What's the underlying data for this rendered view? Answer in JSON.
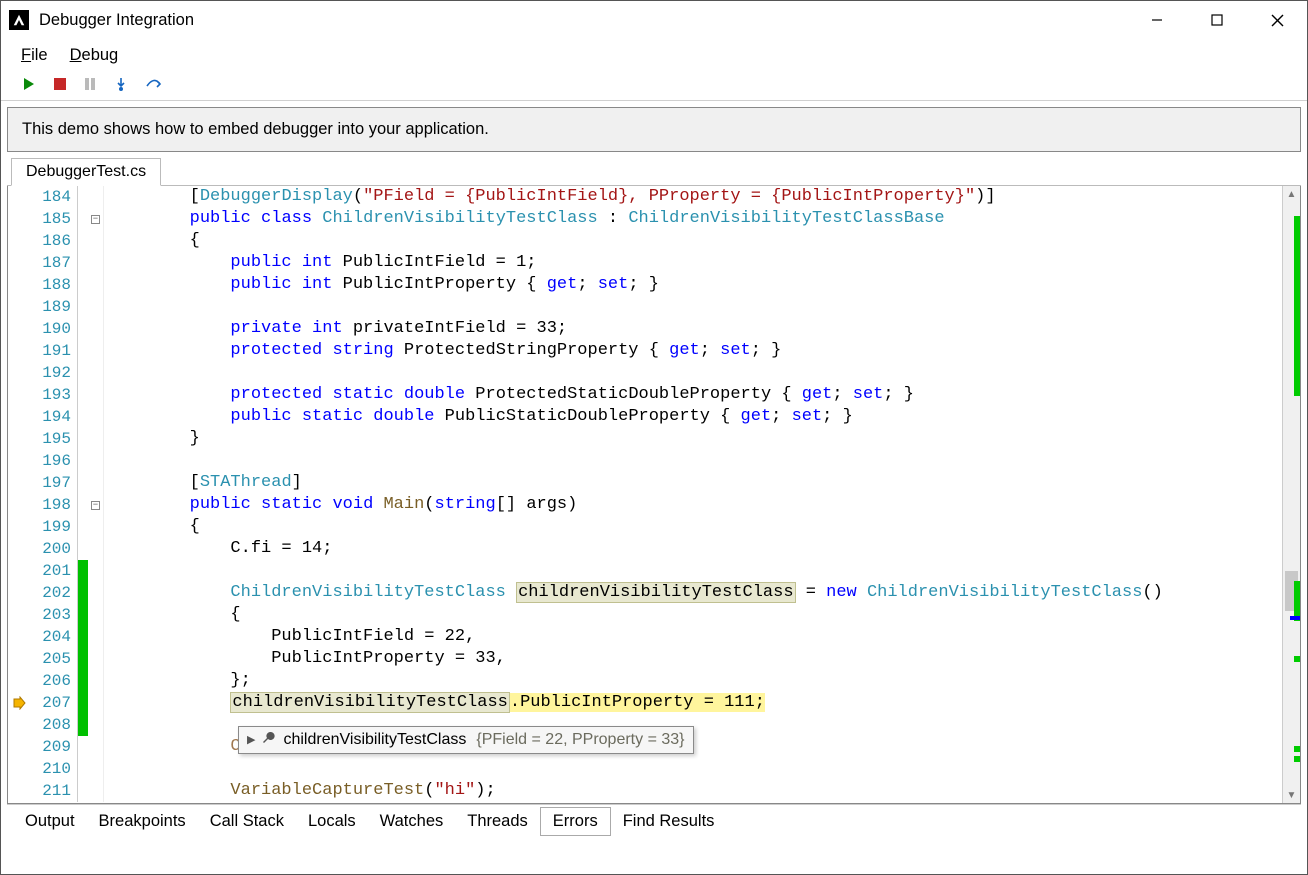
{
  "window": {
    "title": "Debugger Integration"
  },
  "menubar": {
    "file_prefix": "F",
    "file_rest": "ile",
    "debug_prefix": "D",
    "debug_rest": "ebug"
  },
  "info": {
    "text": "This demo shows how to embed debugger into your application."
  },
  "tabs": {
    "file": "DebuggerTest.cs"
  },
  "code": {
    "lines": [
      {
        "n": "184",
        "change": false,
        "fold": "",
        "indent": "        ",
        "tokens": [
          {
            "t": "[",
            "c": ""
          },
          {
            "t": "DebuggerDisplay",
            "c": "attr"
          },
          {
            "t": "(",
            "c": ""
          },
          {
            "t": "\"PField = {PublicIntField}, PProperty = {PublicIntProperty}\"",
            "c": "str"
          },
          {
            "t": ")]",
            "c": ""
          }
        ]
      },
      {
        "n": "185",
        "change": false,
        "fold": "minus",
        "indent": "        ",
        "tokens": [
          {
            "t": "public",
            "c": "kw"
          },
          {
            "t": " ",
            "c": ""
          },
          {
            "t": "class",
            "c": "kw"
          },
          {
            "t": " ",
            "c": ""
          },
          {
            "t": "ChildrenVisibilityTestClass",
            "c": "type"
          },
          {
            "t": " : ",
            "c": ""
          },
          {
            "t": "ChildrenVisibilityTestClassBase",
            "c": "type"
          }
        ]
      },
      {
        "n": "186",
        "change": false,
        "fold": "",
        "indent": "        ",
        "tokens": [
          {
            "t": "{",
            "c": ""
          }
        ]
      },
      {
        "n": "187",
        "change": false,
        "fold": "",
        "indent": "            ",
        "tokens": [
          {
            "t": "public",
            "c": "kw"
          },
          {
            "t": " ",
            "c": ""
          },
          {
            "t": "int",
            "c": "kw"
          },
          {
            "t": " PublicIntField = 1;",
            "c": ""
          }
        ]
      },
      {
        "n": "188",
        "change": false,
        "fold": "",
        "indent": "            ",
        "tokens": [
          {
            "t": "public",
            "c": "kw"
          },
          {
            "t": " ",
            "c": ""
          },
          {
            "t": "int",
            "c": "kw"
          },
          {
            "t": " PublicIntProperty { ",
            "c": ""
          },
          {
            "t": "get",
            "c": "kw"
          },
          {
            "t": "; ",
            "c": ""
          },
          {
            "t": "set",
            "c": "kw"
          },
          {
            "t": "; }",
            "c": ""
          }
        ]
      },
      {
        "n": "189",
        "change": false,
        "fold": "",
        "indent": "",
        "tokens": []
      },
      {
        "n": "190",
        "change": false,
        "fold": "",
        "indent": "            ",
        "tokens": [
          {
            "t": "private",
            "c": "kw"
          },
          {
            "t": " ",
            "c": ""
          },
          {
            "t": "int",
            "c": "kw"
          },
          {
            "t": " privateIntField = 33;",
            "c": ""
          }
        ]
      },
      {
        "n": "191",
        "change": false,
        "fold": "",
        "indent": "            ",
        "tokens": [
          {
            "t": "protected",
            "c": "kw"
          },
          {
            "t": " ",
            "c": ""
          },
          {
            "t": "string",
            "c": "kw"
          },
          {
            "t": " ProtectedStringProperty { ",
            "c": ""
          },
          {
            "t": "get",
            "c": "kw"
          },
          {
            "t": "; ",
            "c": ""
          },
          {
            "t": "set",
            "c": "kw"
          },
          {
            "t": "; }",
            "c": ""
          }
        ]
      },
      {
        "n": "192",
        "change": false,
        "fold": "",
        "indent": "",
        "tokens": []
      },
      {
        "n": "193",
        "change": false,
        "fold": "",
        "indent": "            ",
        "tokens": [
          {
            "t": "protected",
            "c": "kw"
          },
          {
            "t": " ",
            "c": ""
          },
          {
            "t": "static",
            "c": "kw"
          },
          {
            "t": " ",
            "c": ""
          },
          {
            "t": "double",
            "c": "kw"
          },
          {
            "t": " ProtectedStaticDoubleProperty { ",
            "c": ""
          },
          {
            "t": "get",
            "c": "kw"
          },
          {
            "t": "; ",
            "c": ""
          },
          {
            "t": "set",
            "c": "kw"
          },
          {
            "t": "; }",
            "c": ""
          }
        ]
      },
      {
        "n": "194",
        "change": false,
        "fold": "",
        "indent": "            ",
        "tokens": [
          {
            "t": "public",
            "c": "kw"
          },
          {
            "t": " ",
            "c": ""
          },
          {
            "t": "static",
            "c": "kw"
          },
          {
            "t": " ",
            "c": ""
          },
          {
            "t": "double",
            "c": "kw"
          },
          {
            "t": " PublicStaticDoubleProperty { ",
            "c": ""
          },
          {
            "t": "get",
            "c": "kw"
          },
          {
            "t": "; ",
            "c": ""
          },
          {
            "t": "set",
            "c": "kw"
          },
          {
            "t": "; }",
            "c": ""
          }
        ]
      },
      {
        "n": "195",
        "change": false,
        "fold": "",
        "indent": "        ",
        "tokens": [
          {
            "t": "}",
            "c": ""
          }
        ]
      },
      {
        "n": "196",
        "change": false,
        "fold": "",
        "indent": "",
        "tokens": []
      },
      {
        "n": "197",
        "change": false,
        "fold": "",
        "indent": "        ",
        "tokens": [
          {
            "t": "[",
            "c": ""
          },
          {
            "t": "STAThread",
            "c": "attr"
          },
          {
            "t": "]",
            "c": ""
          }
        ]
      },
      {
        "n": "198",
        "change": false,
        "fold": "minus",
        "indent": "        ",
        "tokens": [
          {
            "t": "public",
            "c": "kw"
          },
          {
            "t": " ",
            "c": ""
          },
          {
            "t": "static",
            "c": "kw"
          },
          {
            "t": " ",
            "c": ""
          },
          {
            "t": "void",
            "c": "kw"
          },
          {
            "t": " ",
            "c": ""
          },
          {
            "t": "Main",
            "c": "func"
          },
          {
            "t": "(",
            "c": ""
          },
          {
            "t": "string",
            "c": "kw"
          },
          {
            "t": "[] args)",
            "c": ""
          }
        ]
      },
      {
        "n": "199",
        "change": false,
        "fold": "",
        "indent": "        ",
        "tokens": [
          {
            "t": "{",
            "c": ""
          }
        ]
      },
      {
        "n": "200",
        "change": false,
        "fold": "",
        "indent": "            ",
        "tokens": [
          {
            "t": "C.fi = 14;",
            "c": ""
          }
        ]
      },
      {
        "n": "201",
        "change": true,
        "fold": "",
        "indent": "",
        "tokens": []
      },
      {
        "n": "202",
        "change": true,
        "fold": "",
        "indent": "            ",
        "tokens": [
          {
            "t": "ChildrenVisibilityTestClass",
            "c": "type"
          },
          {
            "t": " ",
            "c": ""
          },
          {
            "t": "childrenVisibilityTestClass",
            "c": "mem",
            "hl": true
          },
          {
            "t": " = ",
            "c": ""
          },
          {
            "t": "new",
            "c": "kw"
          },
          {
            "t": " ",
            "c": ""
          },
          {
            "t": "ChildrenVisibilityTestClass",
            "c": "type"
          },
          {
            "t": "()",
            "c": ""
          }
        ]
      },
      {
        "n": "203",
        "change": true,
        "fold": "",
        "indent": "            ",
        "tokens": [
          {
            "t": "{",
            "c": ""
          }
        ]
      },
      {
        "n": "204",
        "change": true,
        "fold": "",
        "indent": "                ",
        "tokens": [
          {
            "t": "PublicIntField = 22,",
            "c": ""
          }
        ]
      },
      {
        "n": "205",
        "change": true,
        "fold": "",
        "indent": "                ",
        "tokens": [
          {
            "t": "PublicIntProperty = 33,",
            "c": ""
          }
        ]
      },
      {
        "n": "206",
        "change": true,
        "fold": "",
        "indent": "            ",
        "tokens": [
          {
            "t": "};",
            "c": ""
          }
        ]
      },
      {
        "n": "207",
        "change": true,
        "fold": "",
        "indent": "            ",
        "bp": true,
        "exec": true,
        "tokens": [
          {
            "t": "childrenVisibilityTestClass",
            "c": "mem",
            "hl": true
          },
          {
            "t": ".PublicIntProperty = 111;",
            "c": ""
          }
        ]
      },
      {
        "n": "208",
        "change": true,
        "fold": "",
        "indent": "",
        "tokens": []
      },
      {
        "n": "209",
        "change": false,
        "fold": "",
        "indent": "            ",
        "tokens": [
          {
            "t": "CustomEvaluatorsTest",
            "c": "func",
            "ghost": true
          },
          {
            "t": "();",
            "c": "",
            "ghost": true
          }
        ]
      },
      {
        "n": "210",
        "change": false,
        "fold": "",
        "indent": "",
        "tokens": []
      },
      {
        "n": "211",
        "change": false,
        "fold": "",
        "indent": "            ",
        "tokens": [
          {
            "t": "VariableCaptureTest",
            "c": "func"
          },
          {
            "t": "(",
            "c": ""
          },
          {
            "t": "\"hi\"",
            "c": "str"
          },
          {
            "t": ");",
            "c": ""
          }
        ]
      }
    ]
  },
  "tooltip": {
    "name": "childrenVisibilityTestClass",
    "value": "{PField = 22, PProperty = 33}"
  },
  "bottom_tabs": {
    "items": [
      "Output",
      "Breakpoints",
      "Call Stack",
      "Locals",
      "Watches",
      "Threads",
      "Errors",
      "Find Results"
    ],
    "active_index": 6
  }
}
